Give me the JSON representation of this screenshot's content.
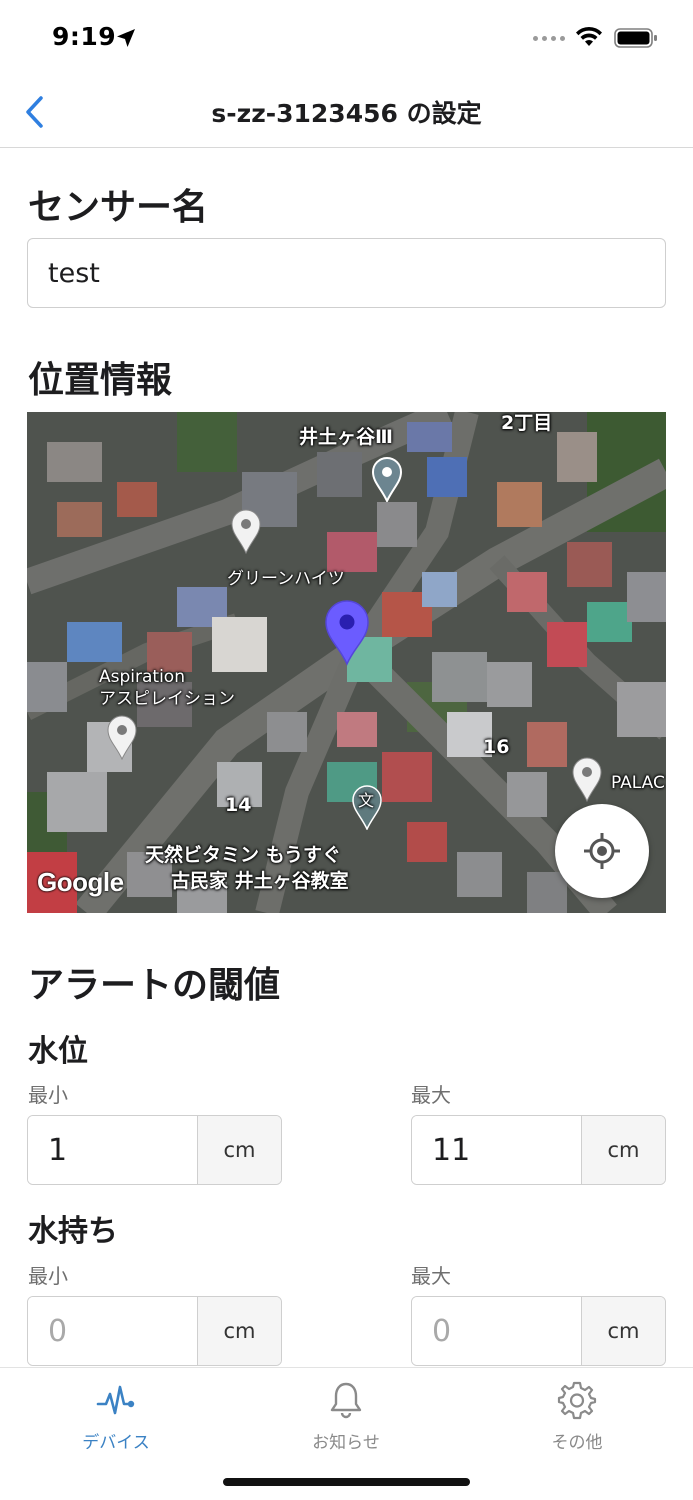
{
  "status_bar": {
    "time": "9:19"
  },
  "nav": {
    "title": "s-zz-3123456 の設定"
  },
  "sensor_name": {
    "heading": "センサー名",
    "value": "test"
  },
  "location": {
    "heading": "位置情報",
    "map_labels": {
      "top_place": "井土ヶ谷Ⅲ",
      "chome": "2丁目",
      "green_heights": "グリーンハイツ",
      "aspiration_en": "Aspiration",
      "aspiration_jp": "アスピレイション",
      "num_16": "16",
      "num_14": "14",
      "palace": "PALAC",
      "school_line1": "天然ビタミン もうすぐ",
      "school_line2": "古民家 井土ヶ谷教室",
      "school_icon": "文"
    },
    "google_logo": "Google"
  },
  "alert": {
    "heading": "アラートの閾値",
    "water_level": {
      "title": "水位",
      "min_label": "最小",
      "max_label": "最大",
      "min_value": "1",
      "max_value": "11",
      "unit": "cm"
    },
    "water_retention": {
      "title": "水持ち",
      "min_label": "最小",
      "max_label": "最大",
      "min_placeholder": "0",
      "max_placeholder": "0",
      "unit": "cm"
    }
  },
  "tabs": [
    {
      "label": "デバイス",
      "icon": "pulse-icon",
      "active": true
    },
    {
      "label": "お知らせ",
      "icon": "bell-icon",
      "active": false
    },
    {
      "label": "その他",
      "icon": "gear-icon",
      "active": false
    }
  ],
  "colors": {
    "accent": "#3b82c4",
    "back_arrow": "#2f7fe0",
    "marker": "#6b5cff"
  }
}
